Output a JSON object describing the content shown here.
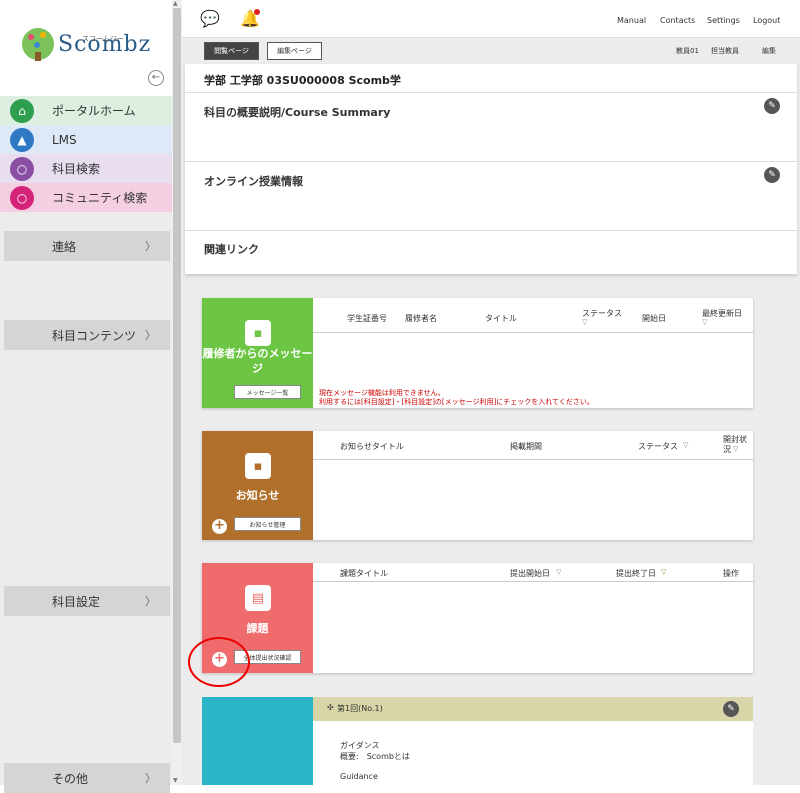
{
  "app": {
    "logo_text": "Scombz",
    "logo_sub": "スコームジー"
  },
  "sidebar": {
    "nav": [
      {
        "label": "ポータルホーム",
        "icon": "home-icon",
        "color": "#2e9e4f"
      },
      {
        "label": "LMS",
        "icon": "graduation-cap-icon",
        "color": "#2f78c4"
      },
      {
        "label": "科目検索",
        "icon": "search-icon",
        "color": "#8a4fa3"
      },
      {
        "label": "コミュニティ検索",
        "icon": "search-icon",
        "color": "#d4247a"
      }
    ],
    "sections": [
      {
        "label": "連絡"
      },
      {
        "label": "科目コンテンツ"
      },
      {
        "label": "科目設定"
      },
      {
        "label": "その他"
      }
    ]
  },
  "topbar": {
    "links": [
      "Manual",
      "Contacts",
      "Settings",
      "Logout"
    ]
  },
  "subbar": {
    "view_page": "閲覧ページ",
    "edit_page": "編集ページ",
    "right": [
      "教員01",
      "担当教員",
      "編集"
    ]
  },
  "course": {
    "title": "学部 工学部 03SU000008 Scomb学",
    "summary_label": "科目の概要説明/Course Summary",
    "online_label": "オンライン授業情報",
    "links_label": "関連リンク"
  },
  "messages": {
    "title": "履修者からのメッセージ",
    "button": "メッセージ一覧",
    "color": "#6cc644",
    "columns": [
      "学生証番号",
      "履修者名",
      "タイトル",
      "ステータス",
      "開始日",
      "最終更新日"
    ],
    "warn1": "現在メッセージ機能は利用できません。",
    "warn2": "利用するには[科目設定]・[科目設定]の[メッセージ利用]にチェックを入れてください。"
  },
  "notices": {
    "title": "お知らせ",
    "button": "お知らせ管理",
    "color": "#b0702b",
    "columns": [
      "お知らせタイトル",
      "掲載期間",
      "ステータス",
      "開封状況"
    ]
  },
  "tasks": {
    "title": "課題",
    "button": "全体提出状況確認",
    "color": "#f06b6b",
    "columns": [
      "課題タイトル",
      "提出開始日",
      "提出終了日",
      "操作"
    ]
  },
  "lesson": {
    "color": "#2ab5c8",
    "header": "第1回(No.1)",
    "header_bg": "#d8d6a8",
    "line1": "ガイダンス",
    "line2": "概要:　Scombとは",
    "line3": "Guidance"
  }
}
